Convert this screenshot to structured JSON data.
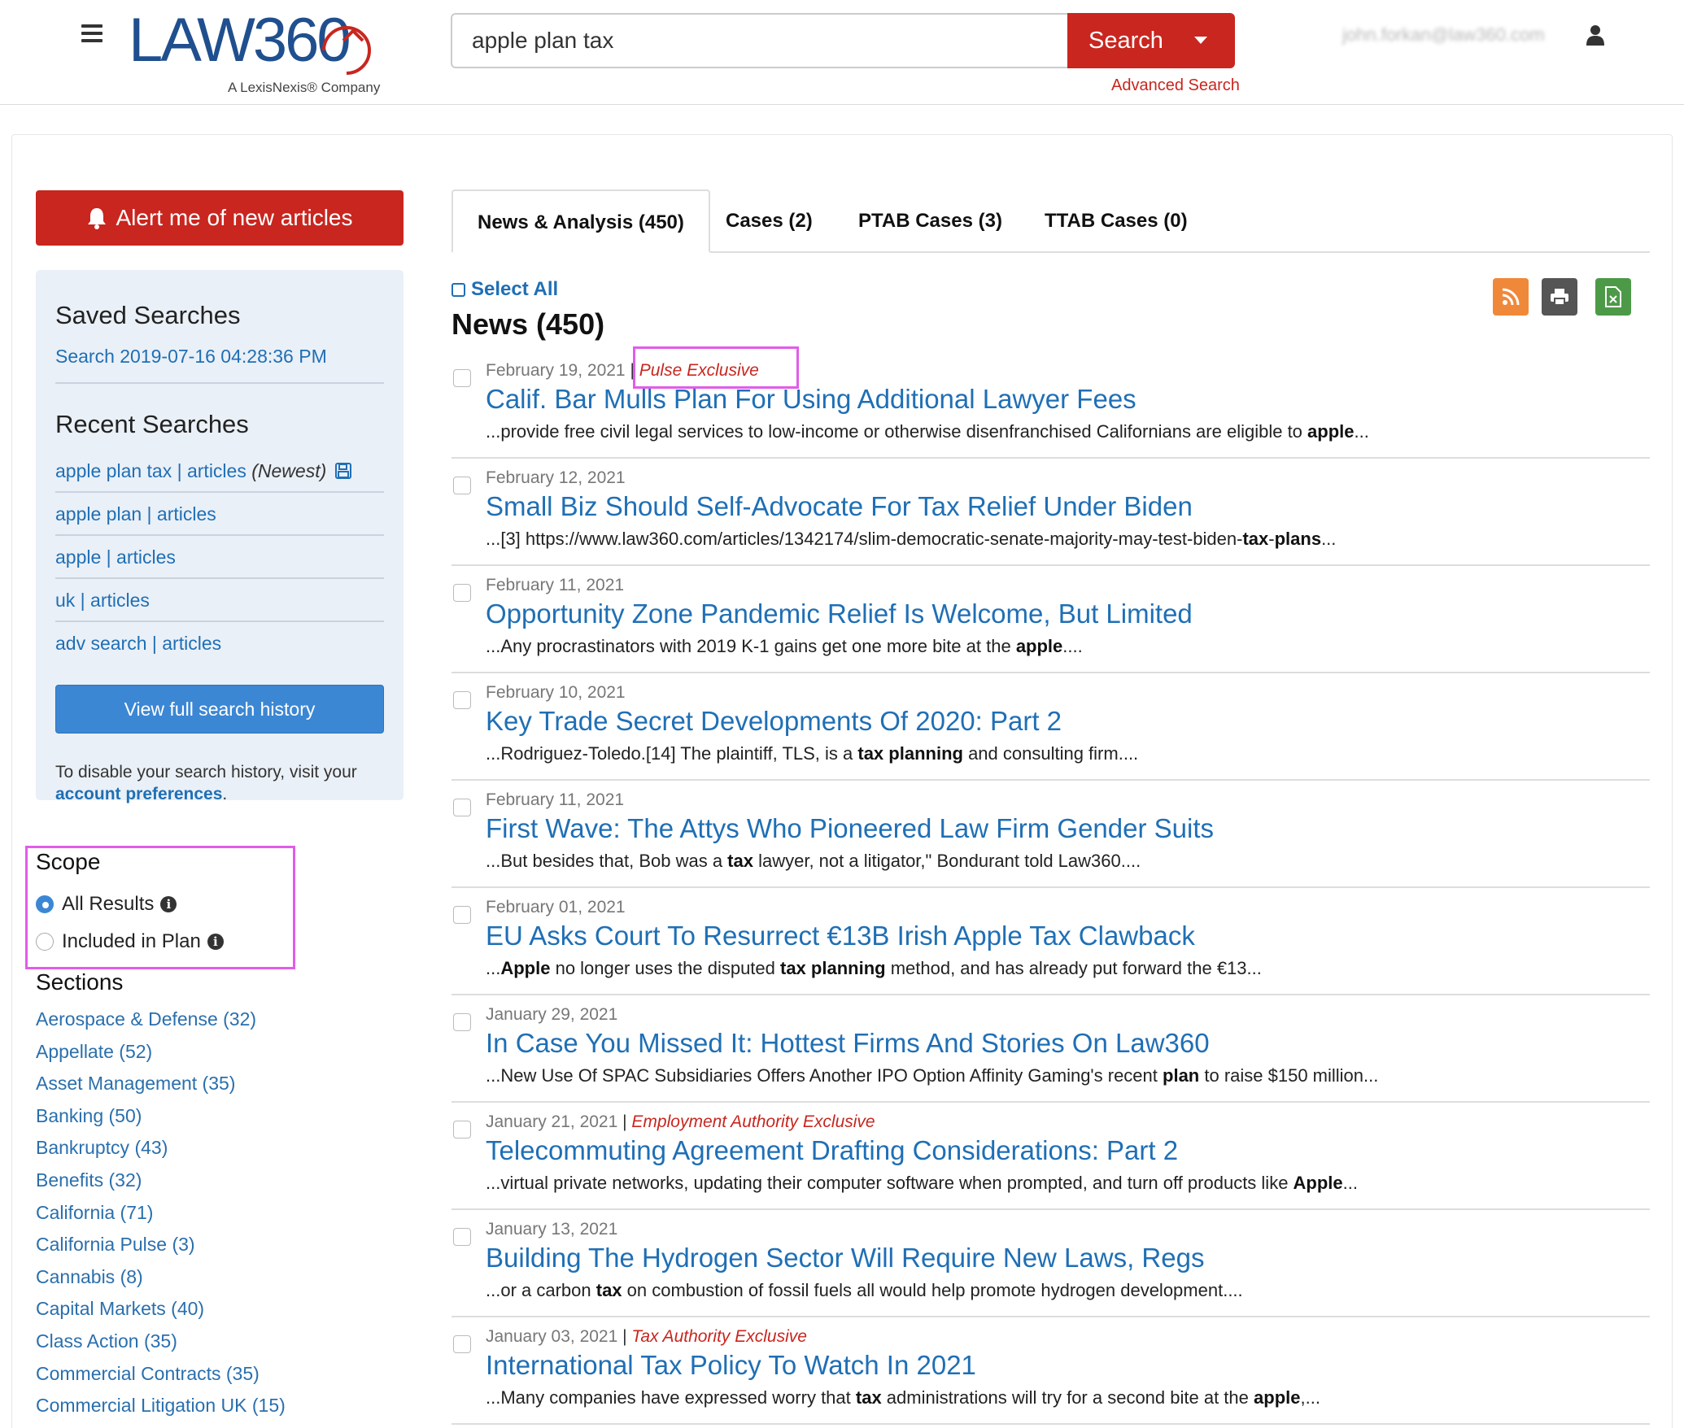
{
  "header": {
    "logo_text": "LAW360",
    "logo_subtitle": "A LexisNexis® Company",
    "search_value": "apple plan tax",
    "search_button": "Search",
    "advanced_search": "Advanced Search",
    "user_email": "john.forkan@law360.com"
  },
  "sidebar": {
    "alert_button": "Alert me of new articles",
    "saved_heading": "Saved Searches",
    "saved_item": "Search 2019-07-16 04:28:36 PM",
    "recent_heading": "Recent Searches",
    "recent_items": [
      {
        "label": "apple plan tax | articles",
        "suffix": "(Newest)"
      },
      {
        "label": "apple plan | articles"
      },
      {
        "label": "apple | articles"
      },
      {
        "label": "uk | articles"
      },
      {
        "label": "adv search | articles"
      }
    ],
    "history_button": "View full search history",
    "disable_note": "To disable your search history, visit your",
    "disable_link": "account preferences",
    "disable_end": ".",
    "scope_title": "Scope",
    "scope_options": [
      "All Results",
      "Included in Plan"
    ],
    "scope_selected": "All Results",
    "sections_title": "Sections",
    "sections": [
      "Aerospace & Defense (32)",
      "Appellate (52)",
      "Asset Management (35)",
      "Banking (50)",
      "Bankruptcy (43)",
      "Benefits (32)",
      "California (71)",
      "California Pulse (3)",
      "Cannabis (8)",
      "Capital Markets (40)",
      "Class Action (35)",
      "Commercial Contracts (35)",
      "Commercial Litigation UK (15)"
    ]
  },
  "main": {
    "tabs": [
      "News & Analysis (450)",
      "Cases (2)",
      "PTAB Cases (3)",
      "TTAB Cases (0)"
    ],
    "active_tab": "News & Analysis (450)",
    "select_all": "Select All",
    "heading": "News (450)",
    "results": [
      {
        "date": "February 19, 2021",
        "exclusive": "Pulse Exclusive",
        "title": "Calif. Bar Mulls Plan For Using Additional Lawyer Fees",
        "snippet": [
          [
            "...provide free civil legal services to low-income or otherwise disenfranchised Californians are eligible to ",
            false
          ],
          [
            "apple",
            true
          ],
          [
            "...",
            false
          ]
        ]
      },
      {
        "date": "February 12, 2021",
        "exclusive": "",
        "title": "Small Biz Should Self-Advocate For Tax Relief Under Biden",
        "snippet": [
          [
            "...[3] https://www.law360.com/articles/1342174/slim-democratic-senate-majority-may-test-biden-",
            false
          ],
          [
            "tax",
            true
          ],
          [
            "-",
            false
          ],
          [
            "plans",
            true
          ],
          [
            "...",
            false
          ]
        ]
      },
      {
        "date": "February 11, 2021",
        "exclusive": "",
        "title": "Opportunity Zone Pandemic Relief Is Welcome, But Limited",
        "snippet": [
          [
            "...Any procrastinators with 2019 K-1 gains get one more bite at the ",
            false
          ],
          [
            "apple",
            true
          ],
          [
            "....",
            false
          ]
        ]
      },
      {
        "date": "February 10, 2021",
        "exclusive": "",
        "title": "Key Trade Secret Developments Of 2020: Part 2",
        "snippet": [
          [
            "...Rodriguez-Toledo.[14] The plaintiff, TLS, is a ",
            false
          ],
          [
            "tax",
            true
          ],
          [
            " ",
            false
          ],
          [
            "planning",
            true
          ],
          [
            " and consulting firm....",
            false
          ]
        ]
      },
      {
        "date": "February 11, 2021",
        "exclusive": "",
        "title": "First Wave: The Attys Who Pioneered Law Firm Gender Suits",
        "snippet": [
          [
            "...But besides that, Bob was a ",
            false
          ],
          [
            "tax",
            true
          ],
          [
            " lawyer, not a litigator,\" Bondurant told Law360....",
            false
          ]
        ]
      },
      {
        "date": "February 01, 2021",
        "exclusive": "",
        "title": "EU Asks Court To Resurrect €13B Irish Apple Tax Clawback",
        "snippet": [
          [
            "...",
            false
          ],
          [
            "Apple",
            true
          ],
          [
            " no longer uses the disputed ",
            false
          ],
          [
            "tax",
            true
          ],
          [
            " ",
            false
          ],
          [
            "planning",
            true
          ],
          [
            " method, and has already put forward the €13...",
            false
          ]
        ]
      },
      {
        "date": "January 29, 2021",
        "exclusive": "",
        "title": "In Case You Missed It: Hottest Firms And Stories On Law360",
        "snippet": [
          [
            "...New Use Of SPAC Subsidiaries Offers Another IPO Option Affinity Gaming's recent ",
            false
          ],
          [
            "plan",
            true
          ],
          [
            " to raise $150 million...",
            false
          ]
        ]
      },
      {
        "date": "January 21, 2021",
        "exclusive": "Employment Authority Exclusive",
        "title": "Telecommuting Agreement Drafting Considerations: Part 2",
        "snippet": [
          [
            "...virtual private networks, updating their computer software when prompted, and turn off products like ",
            false
          ],
          [
            "Apple",
            true
          ],
          [
            "...",
            false
          ]
        ]
      },
      {
        "date": "January 13, 2021",
        "exclusive": "",
        "title": "Building The Hydrogen Sector Will Require New Laws, Regs",
        "snippet": [
          [
            "...or a carbon ",
            false
          ],
          [
            "tax",
            true
          ],
          [
            " on combustion of fossil fuels all would help promote hydrogen development....",
            false
          ]
        ]
      },
      {
        "date": "January 03, 2021",
        "exclusive": "Tax Authority Exclusive",
        "title": "International Tax Policy To Watch In 2021",
        "snippet": [
          [
            "...Many companies have expressed worry that ",
            false
          ],
          [
            "tax",
            true
          ],
          [
            " administrations will try for a second bite at the ",
            false
          ],
          [
            "apple",
            true
          ],
          [
            ",...",
            false
          ]
        ]
      }
    ]
  },
  "colors": {
    "brand_red": "#c8261f",
    "link_blue": "#1f6fb5",
    "annotation_magenta": "#e25ce9",
    "rss_orange": "#f0883a",
    "excel_green": "#4c9a47"
  },
  "icons": [
    "menu-icon",
    "bell-icon",
    "user-icon",
    "save-icon",
    "info-icon",
    "rss-icon",
    "print-icon",
    "excel-icon",
    "chevron-down-icon"
  ]
}
